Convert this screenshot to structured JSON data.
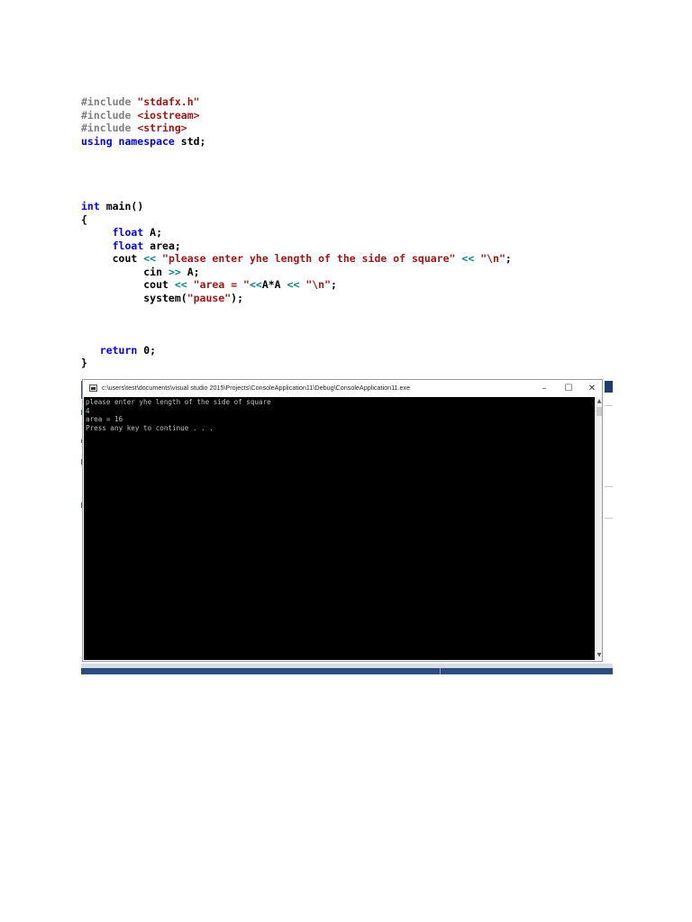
{
  "code_lines": [
    [
      {
        "t": "pp",
        "v": "#include "
      },
      {
        "t": "str",
        "v": "\"stdafx.h\""
      }
    ],
    [
      {
        "t": "pp",
        "v": "#include "
      },
      {
        "t": "str",
        "v": "<iostream>"
      }
    ],
    [
      {
        "t": "pp",
        "v": "#include "
      },
      {
        "t": "str",
        "v": "<string>"
      }
    ],
    [
      {
        "t": "kw",
        "v": "using namespace"
      },
      {
        "t": "pl",
        "v": " std;"
      }
    ],
    [],
    [],
    [],
    [],
    [
      {
        "t": "kw",
        "v": "int"
      },
      {
        "t": "pl",
        "v": " main()"
      }
    ],
    [
      {
        "t": "pl",
        "v": "{"
      }
    ],
    [
      {
        "t": "pl",
        "v": "     "
      },
      {
        "t": "kw",
        "v": "float"
      },
      {
        "t": "pl",
        "v": " A;"
      }
    ],
    [
      {
        "t": "pl",
        "v": "     "
      },
      {
        "t": "kw",
        "v": "float"
      },
      {
        "t": "pl",
        "v": " area;"
      }
    ],
    [
      {
        "t": "pl",
        "v": "     cout "
      },
      {
        "t": "op",
        "v": "<<"
      },
      {
        "t": "pl",
        "v": " "
      },
      {
        "t": "str",
        "v": "\"please enter yhe length of the side of square\""
      },
      {
        "t": "pl",
        "v": " "
      },
      {
        "t": "op",
        "v": "<<"
      },
      {
        "t": "pl",
        "v": " "
      },
      {
        "t": "str",
        "v": "\"\\n\""
      },
      {
        "t": "pl",
        "v": ";"
      }
    ],
    [
      {
        "t": "pl",
        "v": "          cin "
      },
      {
        "t": "op",
        "v": ">>"
      },
      {
        "t": "pl",
        "v": " A;"
      }
    ],
    [
      {
        "t": "pl",
        "v": "          cout "
      },
      {
        "t": "op",
        "v": "<<"
      },
      {
        "t": "pl",
        "v": " "
      },
      {
        "t": "str",
        "v": "\"area = \""
      },
      {
        "t": "op",
        "v": "<<"
      },
      {
        "t": "pl",
        "v": "A*A "
      },
      {
        "t": "op",
        "v": "<<"
      },
      {
        "t": "pl",
        "v": " "
      },
      {
        "t": "str",
        "v": "\"\\n\""
      },
      {
        "t": "pl",
        "v": ";"
      }
    ],
    [
      {
        "t": "pl",
        "v": "          system("
      },
      {
        "t": "str",
        "v": "\"pause\""
      },
      {
        "t": "pl",
        "v": ");"
      }
    ],
    [],
    [],
    [],
    [
      {
        "t": "pl",
        "v": "   "
      },
      {
        "t": "kw",
        "v": "return"
      },
      {
        "t": "pl",
        "v": " 0;"
      }
    ],
    [
      {
        "t": "pl",
        "v": "}"
      }
    ]
  ],
  "console": {
    "title": "c:\\users\\test\\documents\\visual studio 2015\\Projects\\ConsoleApplication11\\Debug\\ConsoleApplication11.exe",
    "minimize_label": "–",
    "maximize_label": "☐",
    "close_label": "✕",
    "output_lines": [
      "please enter yhe length of the side of square",
      "4",
      "area = 16",
      "Press any key to continue . . ."
    ],
    "scroll_up": "▲",
    "scroll_down": "▼"
  },
  "colors": {
    "preprocessor": "#808080",
    "string": "#a31515",
    "keyword": "#0000ff",
    "operator": "#008080",
    "console_bg": "#000000",
    "console_fg": "#c0c0c0"
  }
}
